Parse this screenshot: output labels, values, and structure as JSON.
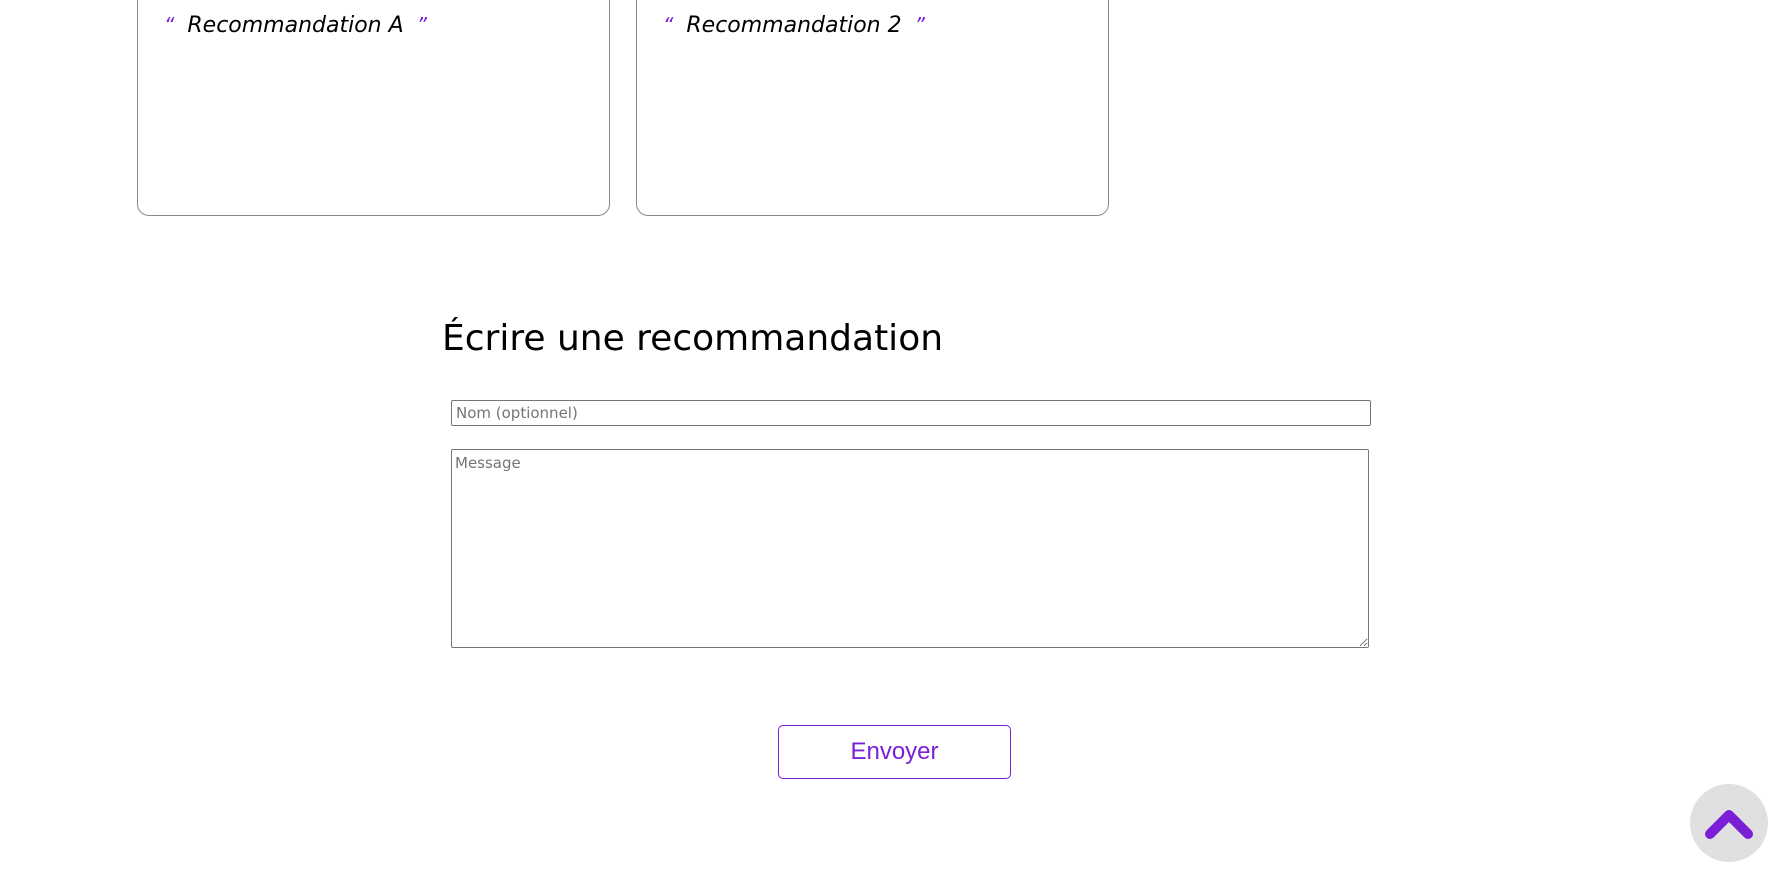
{
  "recommendations": [
    {
      "open_quote": "“",
      "text": "Recommandation A",
      "close_quote": "”"
    },
    {
      "open_quote": "“",
      "text": "Recommandation 2",
      "close_quote": "”"
    }
  ],
  "form": {
    "title": "Écrire une recommandation",
    "name_placeholder": "Nom (optionnel)",
    "name_value": "",
    "message_placeholder": "Message",
    "message_value": "",
    "submit_label": "Envoyer"
  },
  "back_to_top": {
    "icon": "chevron-up-icon"
  },
  "colors": {
    "accent": "#7a1fd6",
    "card_border": "#8a8a8a",
    "back_to_top_bg": "#e0e0e0"
  }
}
